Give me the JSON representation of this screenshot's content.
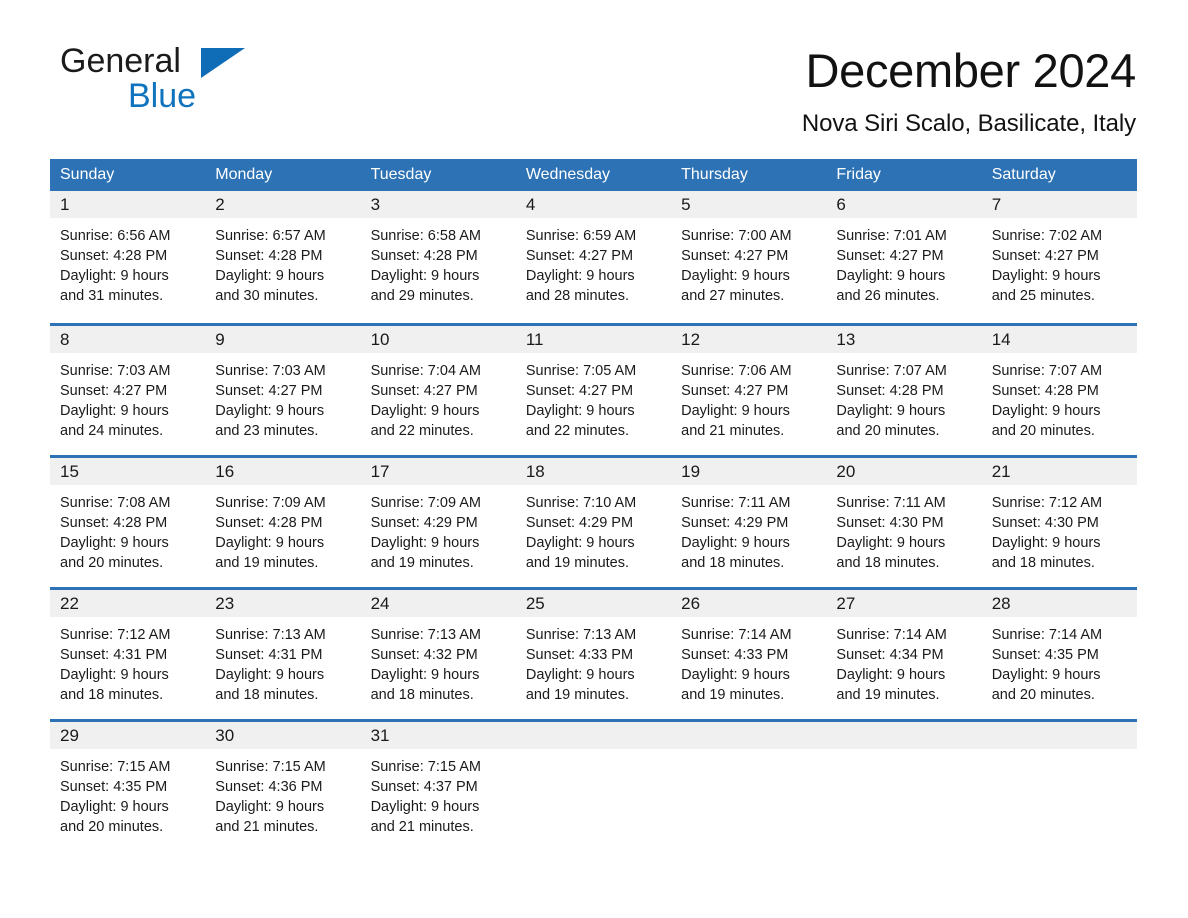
{
  "brand": {
    "name_part1": "General",
    "name_part2": "Blue",
    "accent_color": "#0f6cb6"
  },
  "header": {
    "title": "December 2024",
    "location": "Nova Siri Scalo, Basilicate, Italy"
  },
  "theme": {
    "header_blue": "#2d72b4",
    "day_strip_gray": "#f0f0f0",
    "text_color": "#1a1a1a"
  },
  "weekdays": [
    "Sunday",
    "Monday",
    "Tuesday",
    "Wednesday",
    "Thursday",
    "Friday",
    "Saturday"
  ],
  "weeks": [
    [
      {
        "num": "1",
        "lines": [
          "Sunrise: 6:56 AM",
          "Sunset: 4:28 PM",
          "Daylight: 9 hours",
          "and 31 minutes."
        ]
      },
      {
        "num": "2",
        "lines": [
          "Sunrise: 6:57 AM",
          "Sunset: 4:28 PM",
          "Daylight: 9 hours",
          "and 30 minutes."
        ]
      },
      {
        "num": "3",
        "lines": [
          "Sunrise: 6:58 AM",
          "Sunset: 4:28 PM",
          "Daylight: 9 hours",
          "and 29 minutes."
        ]
      },
      {
        "num": "4",
        "lines": [
          "Sunrise: 6:59 AM",
          "Sunset: 4:27 PM",
          "Daylight: 9 hours",
          "and 28 minutes."
        ]
      },
      {
        "num": "5",
        "lines": [
          "Sunrise: 7:00 AM",
          "Sunset: 4:27 PM",
          "Daylight: 9 hours",
          "and 27 minutes."
        ]
      },
      {
        "num": "6",
        "lines": [
          "Sunrise: 7:01 AM",
          "Sunset: 4:27 PM",
          "Daylight: 9 hours",
          "and 26 minutes."
        ]
      },
      {
        "num": "7",
        "lines": [
          "Sunrise: 7:02 AM",
          "Sunset: 4:27 PM",
          "Daylight: 9 hours",
          "and 25 minutes."
        ]
      }
    ],
    [
      {
        "num": "8",
        "lines": [
          "Sunrise: 7:03 AM",
          "Sunset: 4:27 PM",
          "Daylight: 9 hours",
          "and 24 minutes."
        ]
      },
      {
        "num": "9",
        "lines": [
          "Sunrise: 7:03 AM",
          "Sunset: 4:27 PM",
          "Daylight: 9 hours",
          "and 23 minutes."
        ]
      },
      {
        "num": "10",
        "lines": [
          "Sunrise: 7:04 AM",
          "Sunset: 4:27 PM",
          "Daylight: 9 hours",
          "and 22 minutes."
        ]
      },
      {
        "num": "11",
        "lines": [
          "Sunrise: 7:05 AM",
          "Sunset: 4:27 PM",
          "Daylight: 9 hours",
          "and 22 minutes."
        ]
      },
      {
        "num": "12",
        "lines": [
          "Sunrise: 7:06 AM",
          "Sunset: 4:27 PM",
          "Daylight: 9 hours",
          "and 21 minutes."
        ]
      },
      {
        "num": "13",
        "lines": [
          "Sunrise: 7:07 AM",
          "Sunset: 4:28 PM",
          "Daylight: 9 hours",
          "and 20 minutes."
        ]
      },
      {
        "num": "14",
        "lines": [
          "Sunrise: 7:07 AM",
          "Sunset: 4:28 PM",
          "Daylight: 9 hours",
          "and 20 minutes."
        ]
      }
    ],
    [
      {
        "num": "15",
        "lines": [
          "Sunrise: 7:08 AM",
          "Sunset: 4:28 PM",
          "Daylight: 9 hours",
          "and 20 minutes."
        ]
      },
      {
        "num": "16",
        "lines": [
          "Sunrise: 7:09 AM",
          "Sunset: 4:28 PM",
          "Daylight: 9 hours",
          "and 19 minutes."
        ]
      },
      {
        "num": "17",
        "lines": [
          "Sunrise: 7:09 AM",
          "Sunset: 4:29 PM",
          "Daylight: 9 hours",
          "and 19 minutes."
        ]
      },
      {
        "num": "18",
        "lines": [
          "Sunrise: 7:10 AM",
          "Sunset: 4:29 PM",
          "Daylight: 9 hours",
          "and 19 minutes."
        ]
      },
      {
        "num": "19",
        "lines": [
          "Sunrise: 7:11 AM",
          "Sunset: 4:29 PM",
          "Daylight: 9 hours",
          "and 18 minutes."
        ]
      },
      {
        "num": "20",
        "lines": [
          "Sunrise: 7:11 AM",
          "Sunset: 4:30 PM",
          "Daylight: 9 hours",
          "and 18 minutes."
        ]
      },
      {
        "num": "21",
        "lines": [
          "Sunrise: 7:12 AM",
          "Sunset: 4:30 PM",
          "Daylight: 9 hours",
          "and 18 minutes."
        ]
      }
    ],
    [
      {
        "num": "22",
        "lines": [
          "Sunrise: 7:12 AM",
          "Sunset: 4:31 PM",
          "Daylight: 9 hours",
          "and 18 minutes."
        ]
      },
      {
        "num": "23",
        "lines": [
          "Sunrise: 7:13 AM",
          "Sunset: 4:31 PM",
          "Daylight: 9 hours",
          "and 18 minutes."
        ]
      },
      {
        "num": "24",
        "lines": [
          "Sunrise: 7:13 AM",
          "Sunset: 4:32 PM",
          "Daylight: 9 hours",
          "and 18 minutes."
        ]
      },
      {
        "num": "25",
        "lines": [
          "Sunrise: 7:13 AM",
          "Sunset: 4:33 PM",
          "Daylight: 9 hours",
          "and 19 minutes."
        ]
      },
      {
        "num": "26",
        "lines": [
          "Sunrise: 7:14 AM",
          "Sunset: 4:33 PM",
          "Daylight: 9 hours",
          "and 19 minutes."
        ]
      },
      {
        "num": "27",
        "lines": [
          "Sunrise: 7:14 AM",
          "Sunset: 4:34 PM",
          "Daylight: 9 hours",
          "and 19 minutes."
        ]
      },
      {
        "num": "28",
        "lines": [
          "Sunrise: 7:14 AM",
          "Sunset: 4:35 PM",
          "Daylight: 9 hours",
          "and 20 minutes."
        ]
      }
    ],
    [
      {
        "num": "29",
        "lines": [
          "Sunrise: 7:15 AM",
          "Sunset: 4:35 PM",
          "Daylight: 9 hours",
          "and 20 minutes."
        ]
      },
      {
        "num": "30",
        "lines": [
          "Sunrise: 7:15 AM",
          "Sunset: 4:36 PM",
          "Daylight: 9 hours",
          "and 21 minutes."
        ]
      },
      {
        "num": "31",
        "lines": [
          "Sunrise: 7:15 AM",
          "Sunset: 4:37 PM",
          "Daylight: 9 hours",
          "and 21 minutes."
        ]
      },
      {
        "num": "",
        "lines": []
      },
      {
        "num": "",
        "lines": []
      },
      {
        "num": "",
        "lines": []
      },
      {
        "num": "",
        "lines": []
      }
    ]
  ]
}
